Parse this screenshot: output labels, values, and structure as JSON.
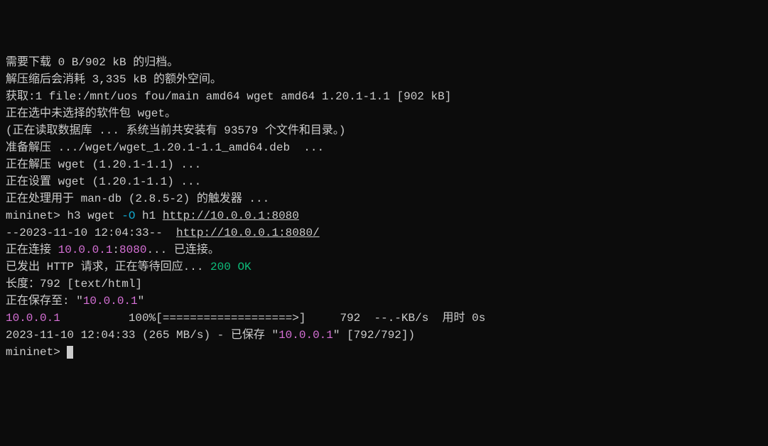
{
  "lines": {
    "l1": "需要下载 0 B/902 kB 的归档。",
    "l2": "解压缩后会消耗 3,335 kB 的额外空间。",
    "l3": "获取:1 file:/mnt/uos fou/main amd64 wget amd64 1.20.1-1.1 [902 kB]",
    "l4": "正在选中未选择的软件包 wget。",
    "l5": "(正在读取数据库 ... 系统当前共安装有 93579 个文件和目录。)",
    "l6": "准备解压 .../wget/wget_1.20.1-1.1_amd64.deb  ...",
    "l7": "正在解压 wget (1.20.1-1.1) ...",
    "l8": "正在设置 wget (1.20.1-1.1) ...",
    "l9": "正在处理用于 man-db (2.8.5-2) 的触发器 ...",
    "l10a": "mininet> ",
    "l10b": "h3 wget ",
    "l10c": "-O",
    "l10d": " h1 ",
    "l10e": "http://10.0.0.1:8080",
    "l11a": "--2023-11-10 12:04:33--  ",
    "l11b": "http://10.0.0.1:8080/",
    "l12a": "正在连接 ",
    "l12b": "10.0.0.1",
    "l12c": ":",
    "l12d": "8080",
    "l12e": "... 已连接。",
    "l13a": "已发出 HTTP 请求，正在等待回应... ",
    "l13b": "200 OK",
    "l14": "长度：792 [text/html]",
    "l15a": "正在保存至: \"",
    "l15b": "10.0.0.1",
    "l15c": "\"",
    "blank1": "",
    "l16a": "10.0.0.1",
    "l16b": "          100%[===================>]     792  --.-KB/s  用时 0s",
    "blank2": "",
    "l17a": "2023-11-10 12:04:33 (265 MB/s) - 已保存 \"",
    "l17b": "10.0.0.1",
    "l17c": "\" [792/792])",
    "blank3": "",
    "l18": "mininet> "
  }
}
